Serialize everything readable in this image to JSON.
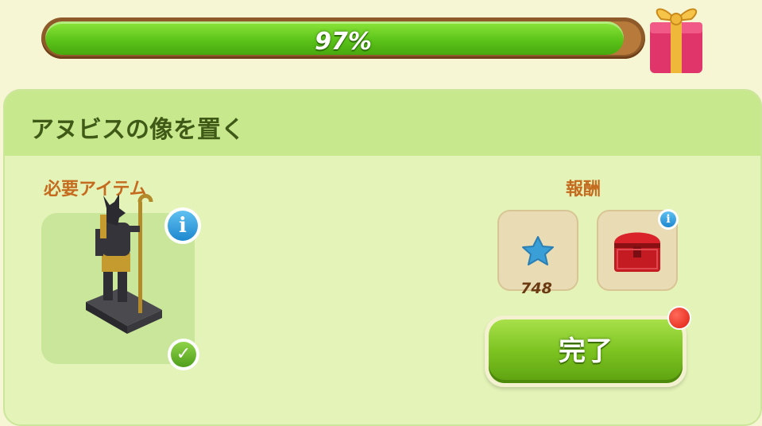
{
  "progress": {
    "percent_value": 97,
    "label": "97%"
  },
  "quest": {
    "title": "アヌビスの像を置く",
    "required_label": "必要アイテム",
    "reward_label": "報酬",
    "required_item": {
      "icon": "anubis-statue-icon",
      "completed": true
    },
    "rewards": [
      {
        "icon": "blue-star-icon",
        "amount": "748"
      },
      {
        "icon": "red-chest-icon",
        "amount": ""
      }
    ],
    "complete_button_label": "完了"
  },
  "colors": {
    "accent_green": "#7cc321",
    "label_orange": "#c56b1f",
    "title_green": "#3f5a16",
    "notification_red": "#e01e10"
  }
}
